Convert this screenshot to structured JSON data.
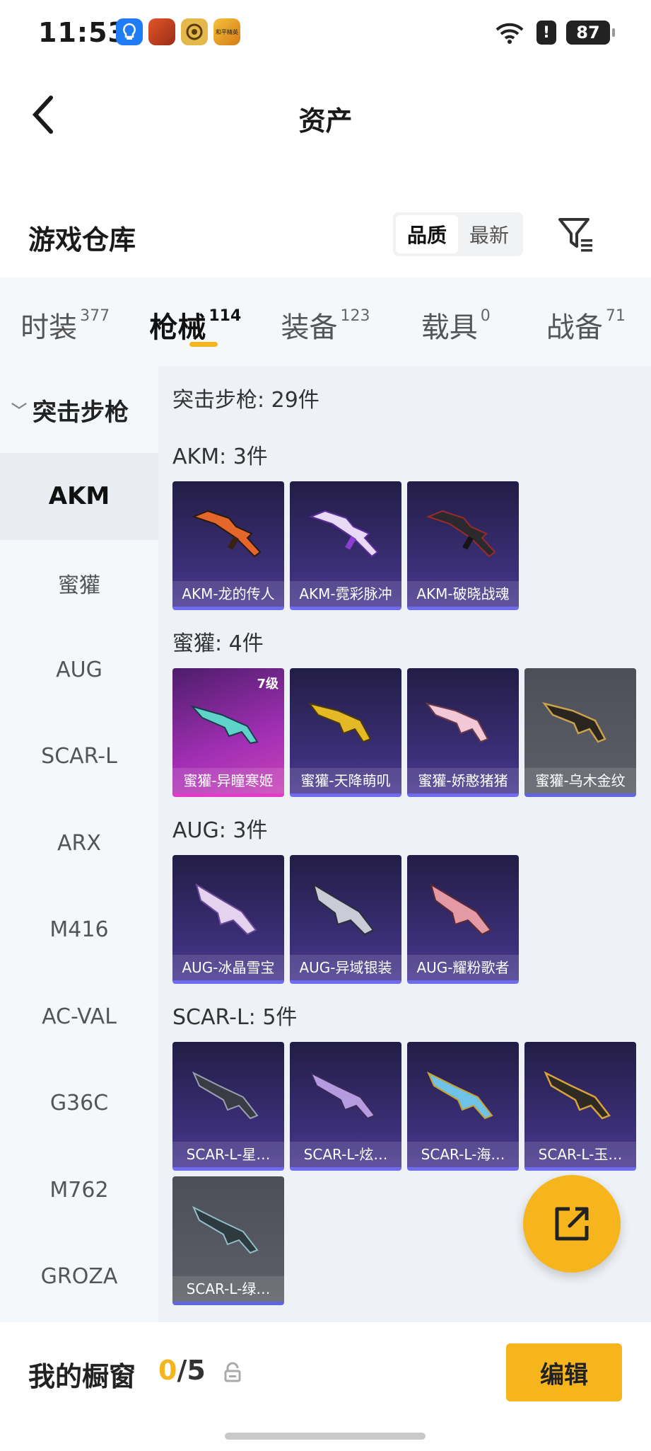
{
  "status_bar": {
    "time": "11:53",
    "battery": "87",
    "app_icon_labels": [
      "",
      "",
      "",
      "和平精英"
    ]
  },
  "header": {
    "title": "资产"
  },
  "warehouse": {
    "title": "游戏仓库",
    "sort_options": [
      "品质",
      "最新"
    ],
    "active_sort": "品质"
  },
  "category_tabs": [
    {
      "label": "时装",
      "count": "377"
    },
    {
      "label": "枪械",
      "count": "114"
    },
    {
      "label": "装备",
      "count": "123"
    },
    {
      "label": "载具",
      "count": "0"
    },
    {
      "label": "战备",
      "count": "71"
    }
  ],
  "sidebar": {
    "group": "突击步枪",
    "items": [
      "AKM",
      "蜜獾",
      "AUG",
      "SCAR-L",
      "ARX",
      "M416",
      "AC-VAL",
      "G36C",
      "M762",
      "GROZA"
    ],
    "active_item": "AKM"
  },
  "main": {
    "title": "突击步枪: 29件",
    "groups": [
      {
        "title": "AKM: 3件",
        "cards": [
          {
            "name": "AKM-龙的传人",
            "style": "purple"
          },
          {
            "name": "AKM-霓彩脉冲",
            "style": "purple"
          },
          {
            "name": "AKM-破晓战魂",
            "style": "purple"
          }
        ]
      },
      {
        "title": "蜜獾: 4件",
        "cards": [
          {
            "name": "蜜獾-异瞳寒姬",
            "style": "pink",
            "level": "7级"
          },
          {
            "name": "蜜獾-天降萌叽",
            "style": "purple"
          },
          {
            "name": "蜜獾-娇憨猪猪",
            "style": "purple"
          },
          {
            "name": "蜜獾-乌木金纹",
            "style": "gray"
          }
        ]
      },
      {
        "title": "AUG: 3件",
        "cards": [
          {
            "name": "AUG-冰晶雪宝",
            "style": "purple"
          },
          {
            "name": "AUG-异域银装",
            "style": "purple"
          },
          {
            "name": "AUG-耀粉歌者",
            "style": "purple"
          }
        ]
      },
      {
        "title": "SCAR-L: 5件",
        "cards": [
          {
            "name": "SCAR-L-星…",
            "style": "purple"
          },
          {
            "name": "SCAR-L-炫…",
            "style": "purple"
          },
          {
            "name": "SCAR-L-海…",
            "style": "purple"
          },
          {
            "name": "SCAR-L-玉…",
            "style": "purple"
          },
          {
            "name": "SCAR-L-绿…",
            "style": "gray"
          }
        ]
      }
    ]
  },
  "bottom_bar": {
    "label": "我的橱窗",
    "current": "0",
    "max": "/5",
    "edit_label": "编辑"
  },
  "colors": {
    "accent": "#f6b51c",
    "card_purple": "#3c2f78",
    "card_pink": "#a22fb4",
    "card_gray": "#5d5f68"
  }
}
